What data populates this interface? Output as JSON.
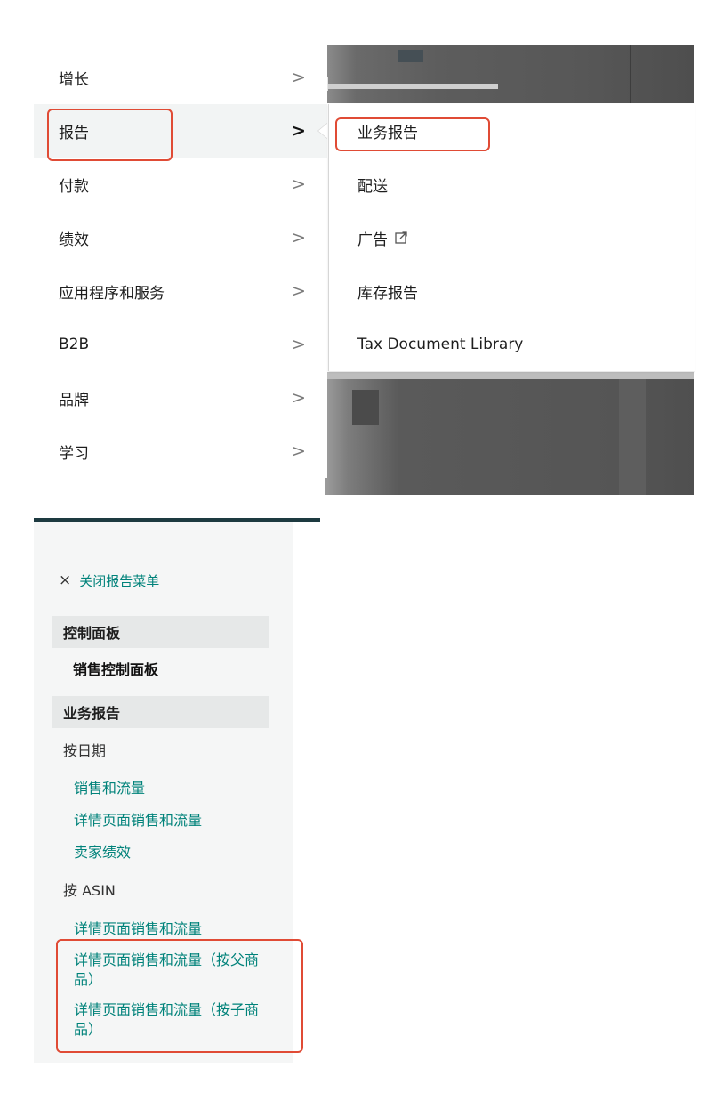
{
  "main_nav": {
    "items": [
      {
        "label": "增长"
      },
      {
        "label": "报告"
      },
      {
        "label": "付款"
      },
      {
        "label": "绩效"
      },
      {
        "label": "应用程序和服务"
      },
      {
        "label": "B2B"
      },
      {
        "label": "品牌"
      },
      {
        "label": "学习"
      }
    ],
    "active_item": "报告",
    "chevron": ">"
  },
  "report_submenu": {
    "items": [
      {
        "label": "业务报告"
      },
      {
        "label": "配送"
      },
      {
        "label": "广告",
        "icon": "external-link-icon"
      },
      {
        "label": "库存报告"
      },
      {
        "label": "Tax Document Library"
      }
    ]
  },
  "report_sidebar": {
    "close_icon": "×",
    "close_label": "关闭报告菜单",
    "sections": [
      {
        "header": "控制面板",
        "items": [
          "销售控制面板"
        ]
      },
      {
        "header": "业务报告",
        "groups": [
          {
            "label": "按日期",
            "links": [
              "销售和流量",
              "详情页面销售和流量",
              "卖家绩效"
            ]
          },
          {
            "label": "按 ASIN",
            "links": [
              "详情页面销售和流量",
              "详情页面销售和流量（按父商品）",
              "详情页面销售和流量（按子商品）"
            ]
          }
        ]
      }
    ]
  },
  "colors": {
    "link": "#00827a",
    "highlight": "#e04b35",
    "header_bg": "#e6e8e8",
    "panel_bg": "#f5f6f6",
    "topbar": "#1d3a40"
  }
}
